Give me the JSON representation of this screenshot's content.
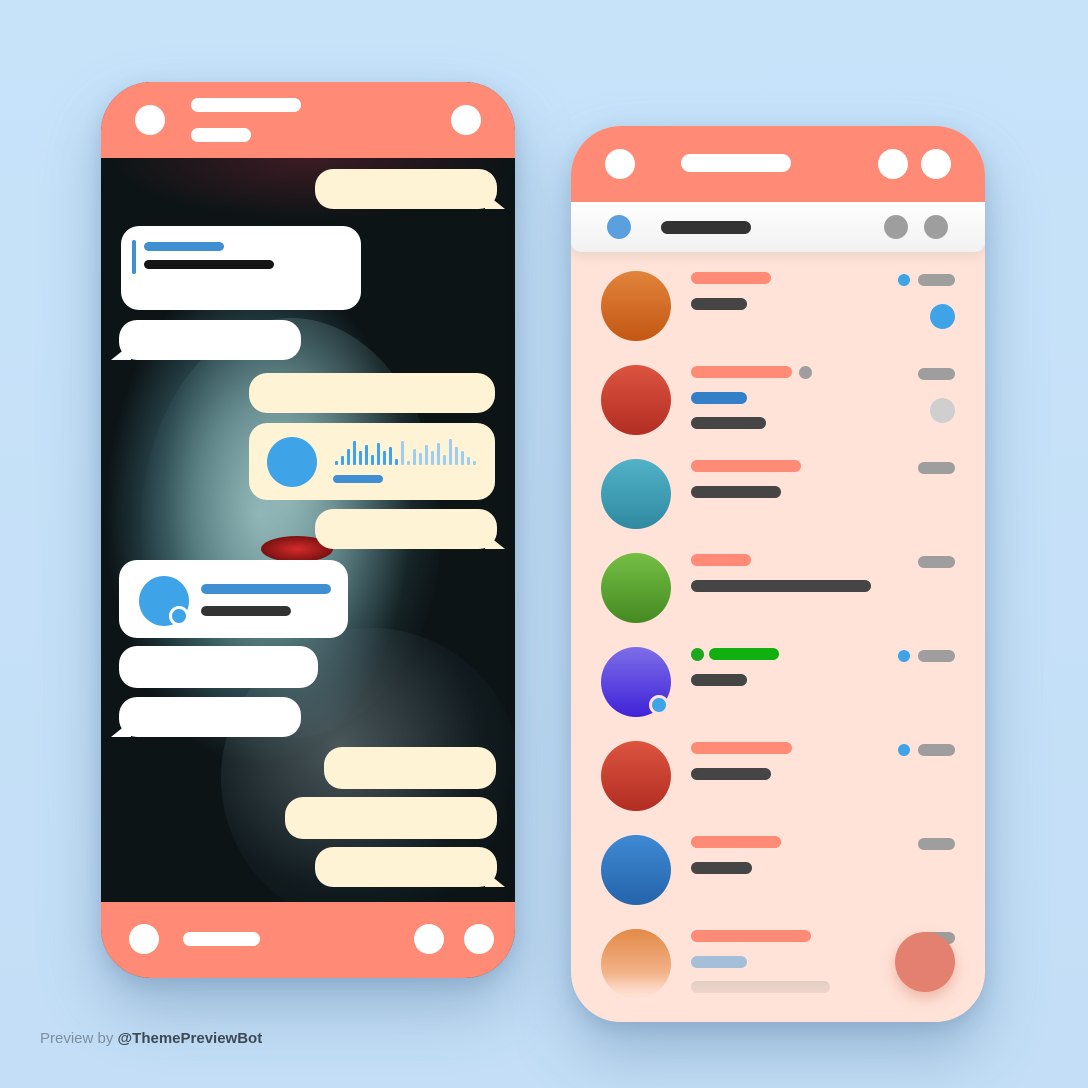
{
  "footer": {
    "prefix": "Preview by",
    "handle": "@ThemePreviewBot"
  },
  "colors": {
    "accent": "#ff8a75",
    "bubble_out": "#fff3d6",
    "bubble_in": "#ffffff",
    "link_blue": "#3fa3e8",
    "list_bg": "#ffe3d8",
    "placeholder_dark": "#454545",
    "placeholder_grey": "#9e9e9e"
  },
  "left_phone": {
    "header_icons": [
      "back-icon",
      "title-placeholder",
      "subtitle-placeholder",
      "menu-icon"
    ],
    "bottom_icons": [
      "attach-icon",
      "input-placeholder",
      "emoji-icon",
      "mic-icon"
    ]
  },
  "right_phone": {
    "header_icons": [
      "menu-icon",
      "title-placeholder",
      "search-icon",
      "more-icon"
    ],
    "pinned_icons": [
      "pin-dot",
      "pinned-placeholder",
      "action-icon",
      "close-icon"
    ],
    "avatar_colors": [
      "#d9631e",
      "#c43a30",
      "#3c9bb2",
      "#5aa332",
      "#5b3ee0",
      "#c43a30",
      "#2f78c4",
      "#e38947"
    ],
    "fab_icon": "compose-icon"
  }
}
